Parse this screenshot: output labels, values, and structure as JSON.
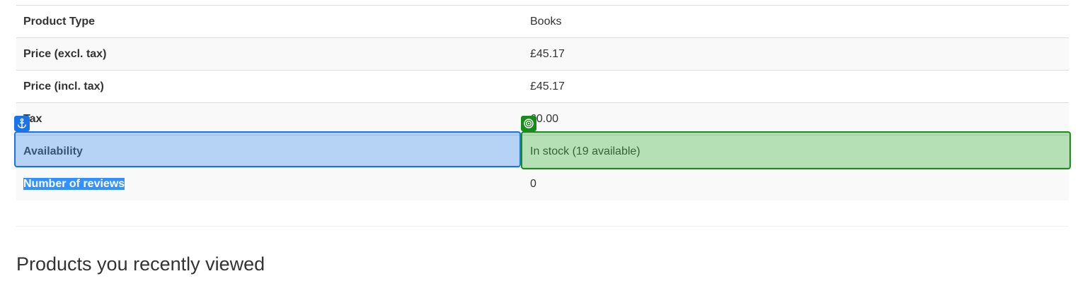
{
  "product_info": {
    "rows": [
      {
        "label": "Product Type",
        "value": "Books"
      },
      {
        "label": "Price (excl. tax)",
        "value": "£45.17"
      },
      {
        "label": "Price (incl. tax)",
        "value": "£45.17"
      },
      {
        "label": "Tax",
        "value": "£0.00"
      },
      {
        "label": "Availability",
        "value": "In stock (19 available)"
      },
      {
        "label": "Number of reviews",
        "value": "0"
      }
    ]
  },
  "highlights": {
    "anchor_icon": "anchor-icon",
    "target_icon": "target-icon",
    "anchor_color": "#1a73e8",
    "target_color": "#1a8a1a"
  },
  "recently_viewed": {
    "heading": "Products you recently viewed"
  }
}
